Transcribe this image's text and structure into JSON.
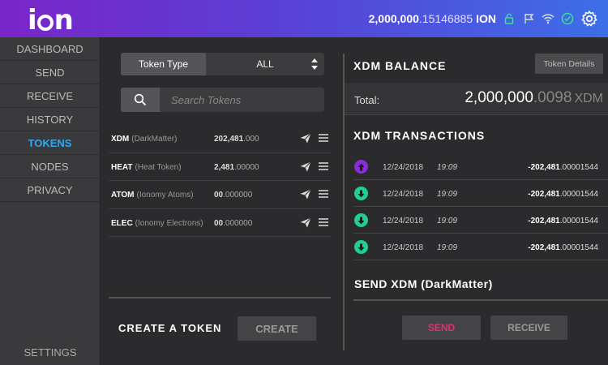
{
  "header": {
    "logo": "ion",
    "balance_int": "2,000,000",
    "balance_dec": ".15146885",
    "balance_currency": "ION",
    "icons": [
      "lock-icon",
      "flag-icon",
      "network-icon",
      "check-icon",
      "gear-icon"
    ]
  },
  "sidebar": {
    "items": [
      {
        "label": "DASHBOARD"
      },
      {
        "label": "SEND"
      },
      {
        "label": "RECEIVE"
      },
      {
        "label": "HISTORY"
      },
      {
        "label": "TOKENS"
      },
      {
        "label": "NODES"
      },
      {
        "label": "PRIVACY"
      }
    ],
    "active": "TOKENS",
    "settings_label": "SETTINGS"
  },
  "tokens_panel": {
    "token_type_label": "Token Type",
    "token_type_value": "ALL",
    "search_placeholder": "Search Tokens",
    "tokens": [
      {
        "symbol": "XDM",
        "name": "(DarkMatter)",
        "amount_int": "202,481",
        "amount_dec": ".000"
      },
      {
        "symbol": "HEAT",
        "name": "(Heat Token)",
        "amount_int": "2,481",
        "amount_dec": ".00000"
      },
      {
        "symbol": "ATOM",
        "name": "(Ionomy Atoms)",
        "amount_int": "00",
        "amount_dec": ".000000"
      },
      {
        "symbol": "ELEC",
        "name": "(Ionomy Electrons)",
        "amount_int": "00",
        "amount_dec": ".000000"
      }
    ],
    "create_label": "CREATE A TOKEN",
    "create_button": "CREATE"
  },
  "detail_panel": {
    "balance_title": "XDM BALANCE",
    "details_button": "Token Details",
    "total_label": "Total:",
    "total_int": "2,000,000",
    "total_dec": ".0098",
    "total_currency": "XDM",
    "tx_title": "XDM TRANSACTIONS",
    "transactions": [
      {
        "direction": "out",
        "date": "12/24/2018",
        "time": "19:09",
        "amount_int": "-202,481",
        "amount_dec": ".00001544"
      },
      {
        "direction": "in",
        "date": "12/24/2018",
        "time": "19:09",
        "amount_int": "-202,481",
        "amount_dec": ".00001544"
      },
      {
        "direction": "in",
        "date": "12/24/2018",
        "time": "19:09",
        "amount_int": "-202,481",
        "amount_dec": ".00001544"
      },
      {
        "direction": "in",
        "date": "12/24/2018",
        "time": "19:09",
        "amount_int": "-202,481",
        "amount_dec": ".00001544"
      }
    ],
    "send_title": "SEND XDM (DarkMatter)",
    "send_button": "SEND",
    "receive_button": "RECEIVE"
  },
  "colors": {
    "accent": "#2ea8ef",
    "send_red": "#e0306f",
    "incoming_green": "#1fd18f",
    "outgoing_purple": "#8a2be2"
  }
}
